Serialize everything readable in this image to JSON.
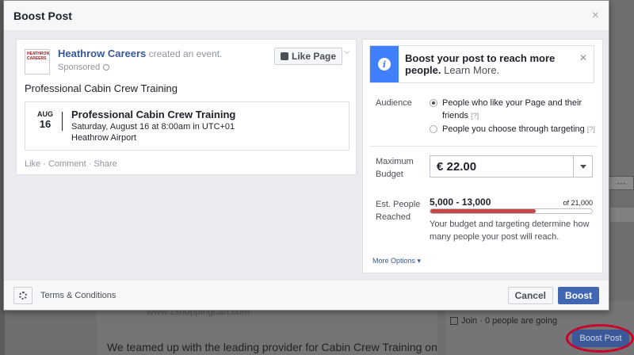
{
  "background": {
    "url_text": "www.1shoppingcart.com",
    "teaser_text": "We teamed up with the leading provider for Cabin Crew Training on",
    "join_text": "Join · 0 people are going",
    "boost_post_label": "Boost Post",
    "more_dots": "···"
  },
  "modal": {
    "title": "Boost Post",
    "close_icon": "×"
  },
  "post": {
    "logo_text": "HEATHROW CAREERS",
    "page_name": "Heathrow Careers",
    "action_text": "created an event.",
    "sponsored": "Sponsored",
    "like_page_label": "Like Page",
    "text": "Professional Cabin Crew Training",
    "event": {
      "month": "AUG",
      "day": "16",
      "title": "Professional Cabin Crew Training",
      "when": "Saturday, August 16 at 8:00am in UTC+01",
      "where": "Heathrow Airport"
    },
    "actions": "Like · Comment · Share"
  },
  "panel": {
    "info_bold": "Boost your post to reach more people.",
    "info_link": "Learn More.",
    "audience_label": "Audience",
    "audience_options": [
      {
        "label": "People who like your Page and their friends",
        "help": "[?]",
        "selected": true
      },
      {
        "label": "People you choose through targeting",
        "help": "[?]",
        "selected": false
      }
    ],
    "budget_label_1": "Maximum",
    "budget_label_2": "Budget",
    "budget_value": "€ 22.00",
    "reach_label_1": "Est. People",
    "reach_label_2": "Reached",
    "reach_range": "5,000 - 13,000",
    "reach_total": "of 21,000",
    "reach_fraction": 0.65,
    "reach_help": "Your budget and targeting determine how many people your post will reach.",
    "more_options": "More Options ▾"
  },
  "footer": {
    "terms": "Terms & Conditions",
    "cancel": "Cancel",
    "boost": "Boost"
  },
  "colors": {
    "brand": "#4267b2",
    "info_accent": "#4080ff",
    "reach_fill": "#c44848"
  }
}
